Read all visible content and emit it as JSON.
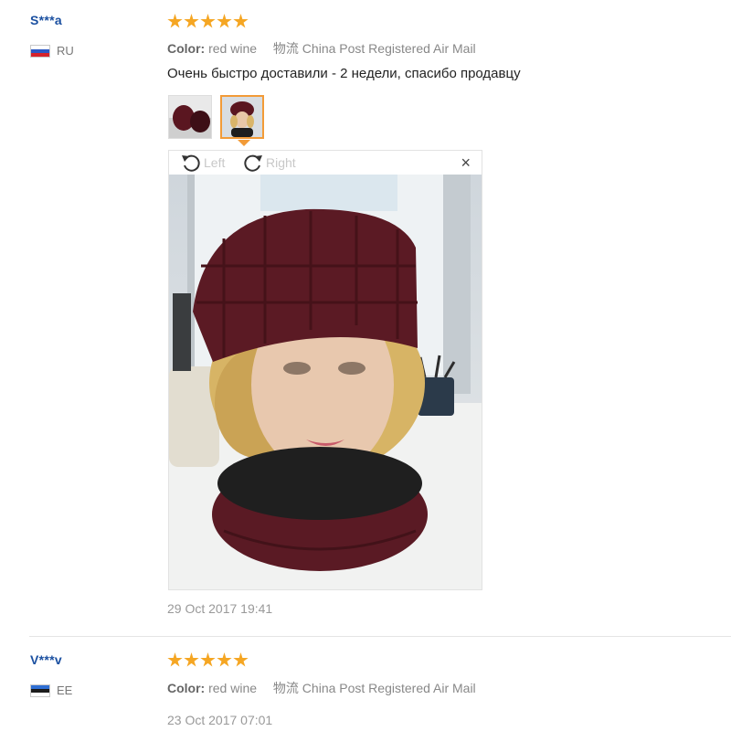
{
  "reviews": [
    {
      "user": "S***a",
      "country": "RU",
      "rating": 5,
      "color_label": "Color:",
      "color_value": "red wine",
      "shipping": "物流 China Post Registered Air Mail",
      "text": "Очень быстро доставили - 2 недели, спасибо продавцу",
      "viewer": {
        "rotate_left": "Left",
        "rotate_right": "Right",
        "close": "×"
      },
      "date": "29 Oct 2017 19:41"
    },
    {
      "user": "V***v",
      "country": "EE",
      "rating": 5,
      "color_label": "Color:",
      "color_value": "red wine",
      "shipping": "物流 China Post Registered Air Mail",
      "date": "23 Oct 2017 07:01"
    }
  ],
  "colors": {
    "star": "#f5a623",
    "username": "#1a4fa0",
    "thumb_selected": "#f29b38"
  }
}
